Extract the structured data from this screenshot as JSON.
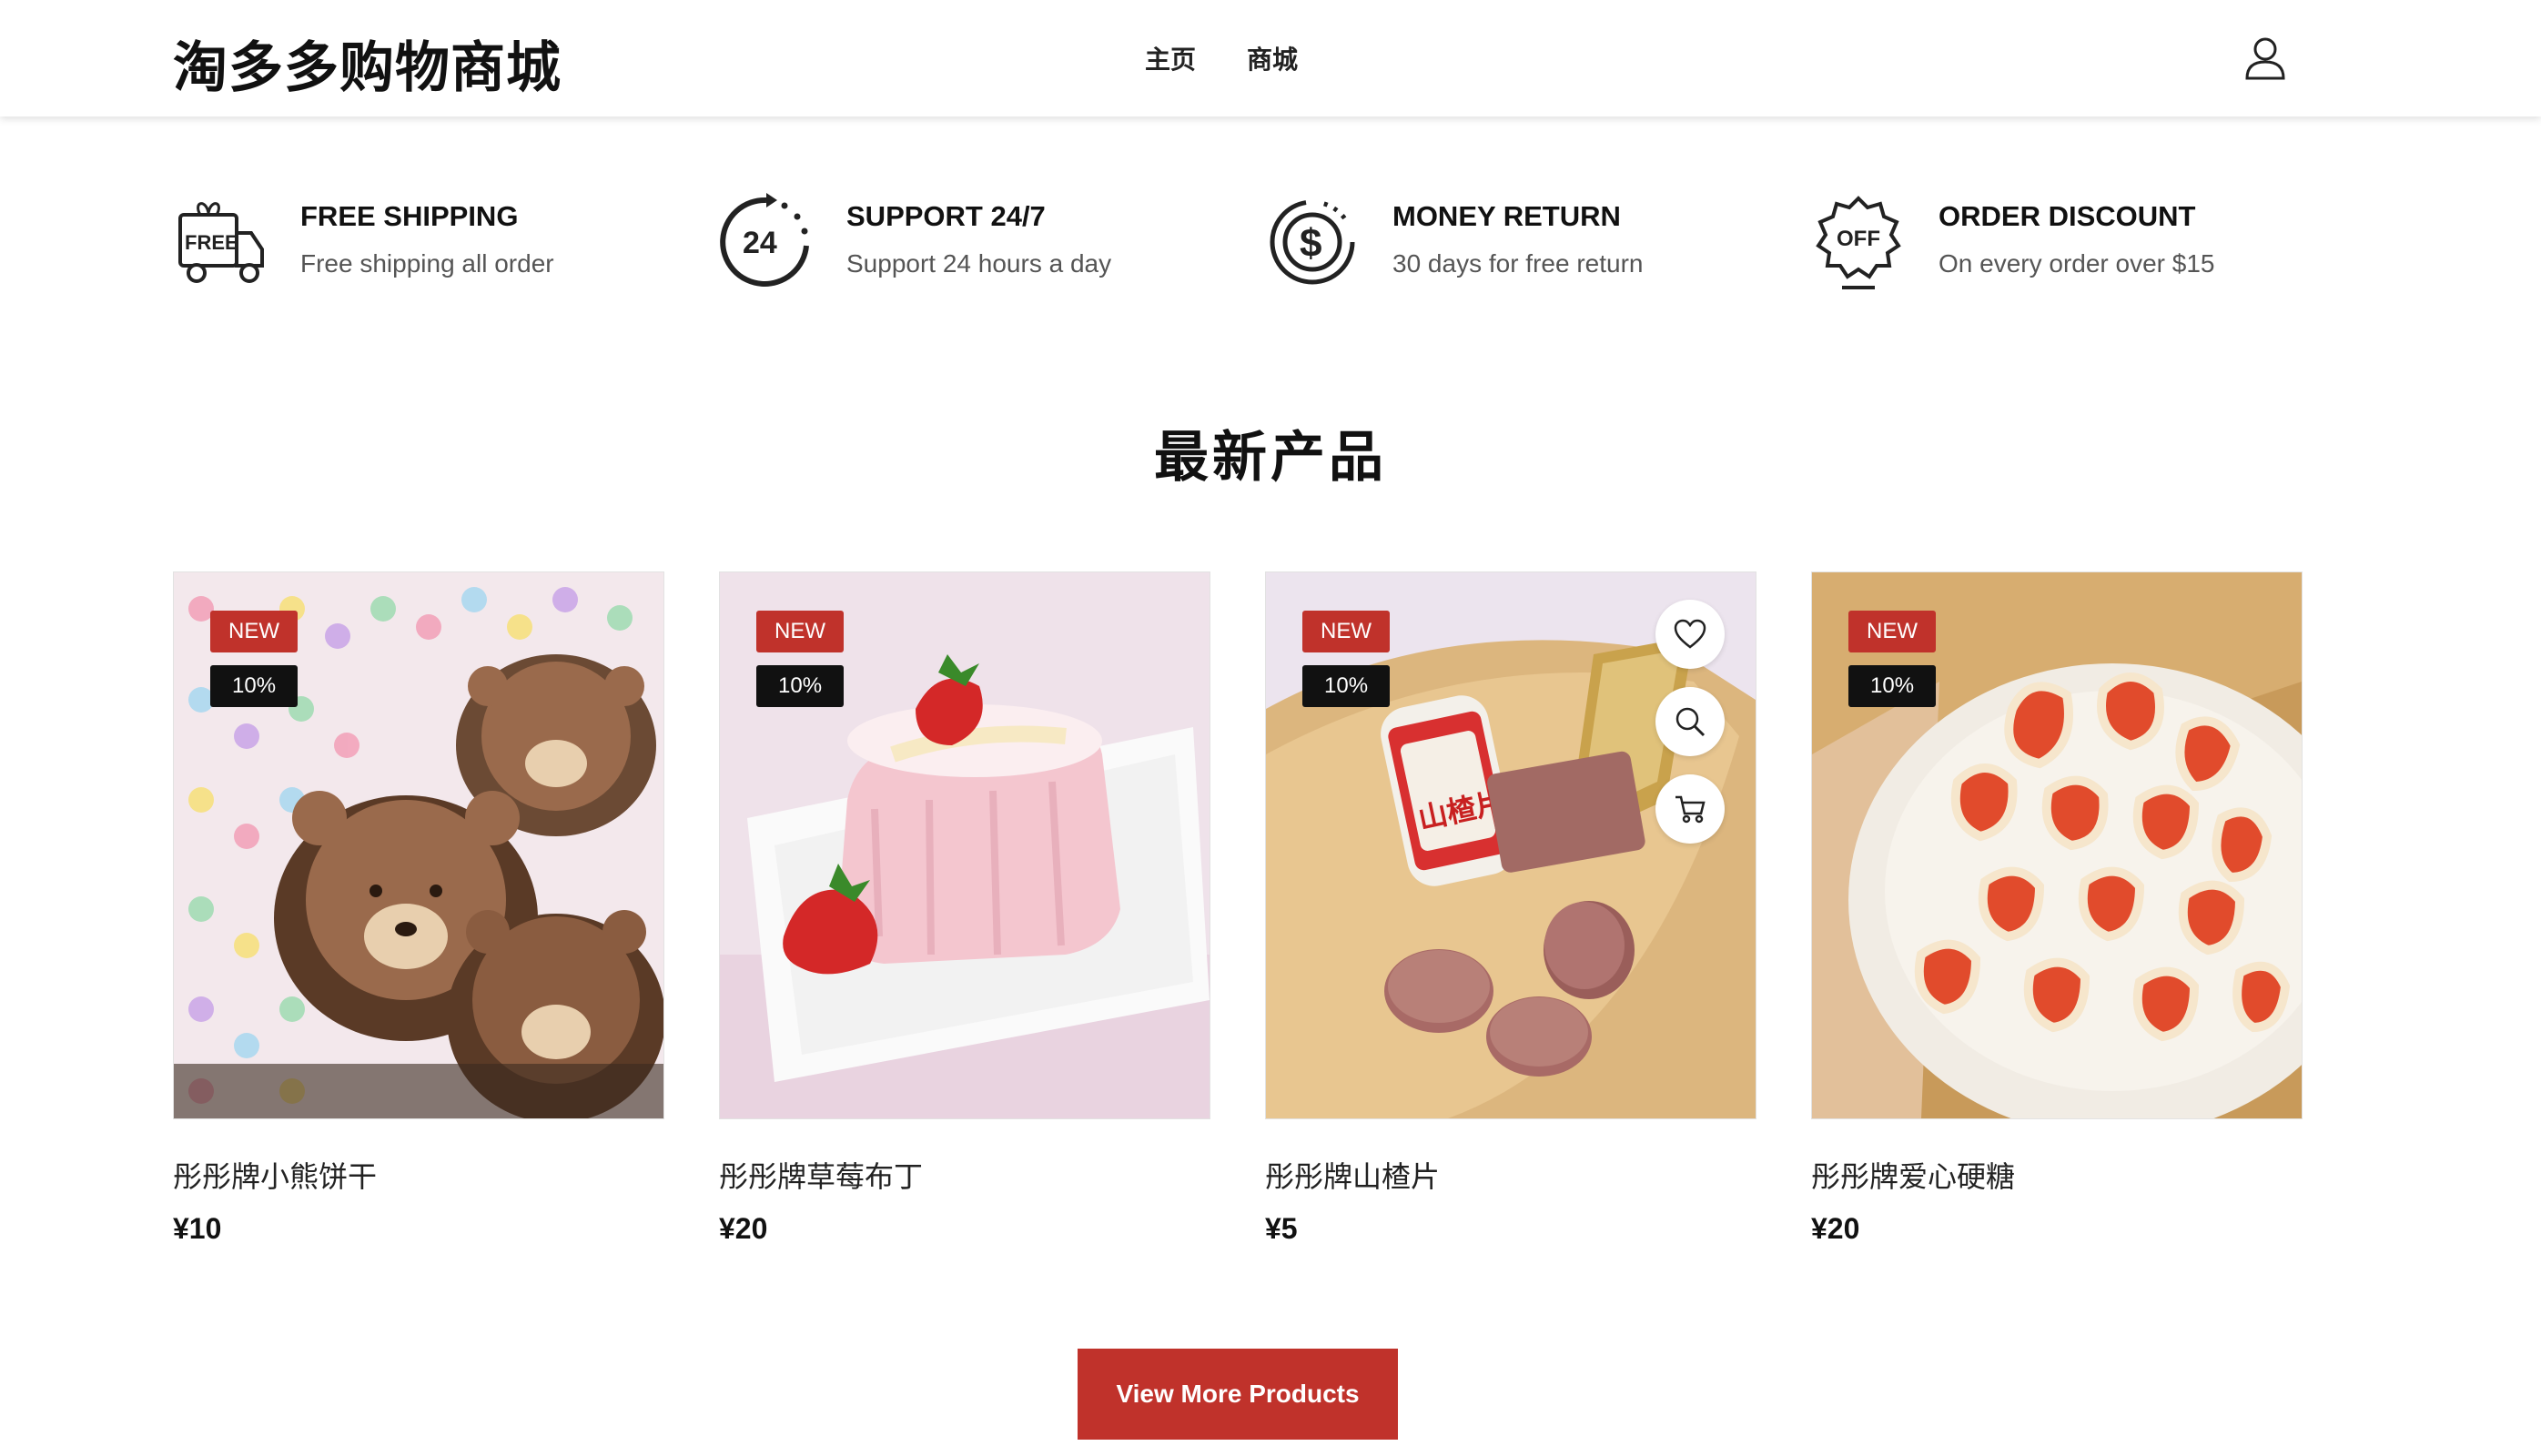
{
  "header": {
    "brand": "淘多多购物商城",
    "nav": [
      "主页",
      "商城"
    ],
    "user_icon": "user-icon"
  },
  "features": [
    {
      "icon": "free-shipping-truck-icon",
      "title": "FREE SHIPPING",
      "desc": "Free shipping all order"
    },
    {
      "icon": "support-24-icon",
      "title": "SUPPORT 24/7",
      "desc": "Support 24 hours a day"
    },
    {
      "icon": "money-return-icon",
      "title": "MONEY RETURN",
      "desc": "30 days for free return"
    },
    {
      "icon": "order-discount-icon",
      "title": "ORDER DISCOUNT",
      "desc": "On every order over $15"
    }
  ],
  "section_title": "最新产品",
  "products": [
    {
      "name": "彤彤牌小熊饼干",
      "price": "¥10",
      "badge_new": "NEW",
      "badge_off": "10%"
    },
    {
      "name": "彤彤牌草莓布丁",
      "price": "¥20",
      "badge_new": "NEW",
      "badge_off": "10%"
    },
    {
      "name": "彤彤牌山楂片",
      "price": "¥5",
      "badge_new": "NEW",
      "badge_off": "10%"
    },
    {
      "name": "彤彤牌爱心硬糖",
      "price": "¥20",
      "badge_new": "NEW",
      "badge_off": "10%"
    }
  ],
  "product_actions": [
    "heart-icon",
    "search-icon",
    "cart-icon"
  ],
  "more_button": "View More Products",
  "colors": {
    "accent": "#c0322b",
    "badge_dark": "#111111"
  }
}
